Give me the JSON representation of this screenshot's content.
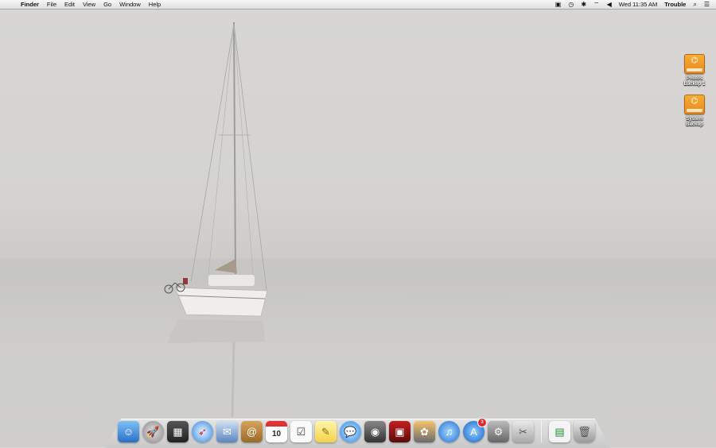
{
  "menubar": {
    "apple_glyph": "",
    "app_name": "Finder",
    "menus": [
      "File",
      "Edit",
      "View",
      "Go",
      "Window",
      "Help"
    ],
    "clock": "Wed 11:35 AM",
    "user": "Trouble"
  },
  "desktop": {
    "drives": [
      {
        "line1": "Photos",
        "line2": "Backup 1"
      },
      {
        "line1": "System",
        "line2": "Backup"
      }
    ]
  },
  "dock": {
    "calendar_day": "10",
    "appstore_badge": "3"
  }
}
